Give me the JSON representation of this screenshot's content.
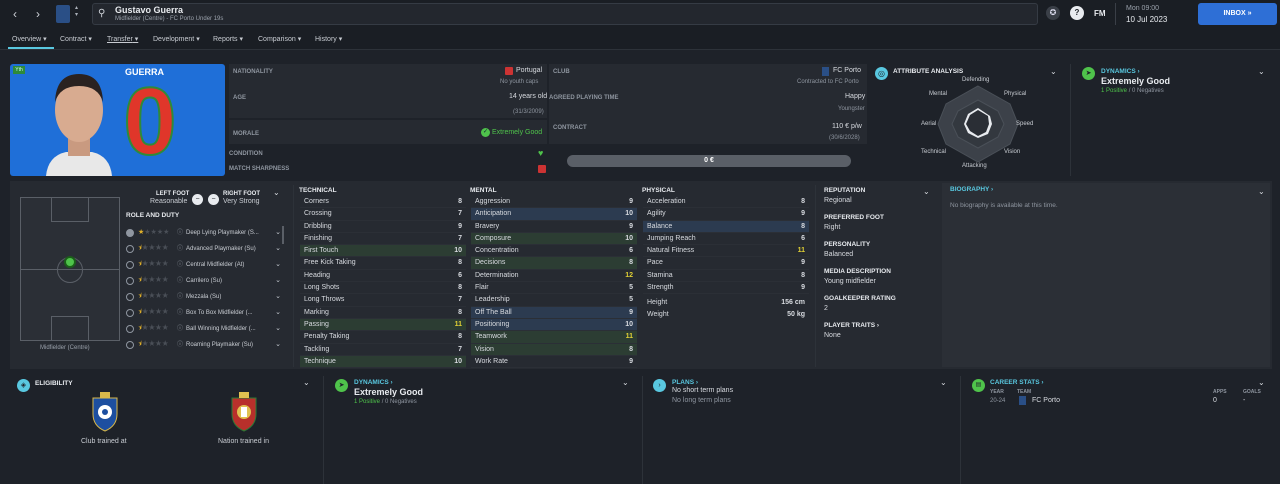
{
  "top": {
    "player_name": "Gustavo Guerra",
    "player_subtitle": "Midfielder (Centre) - FC Porto Under 19s",
    "day_time": "Mon 09:00",
    "date": "10 Jul 2023",
    "fm": "FM",
    "inbox": "INBOX"
  },
  "tabs": [
    "Overview",
    "Contract",
    "Transfer",
    "Development",
    "Reports",
    "Comparison",
    "History"
  ],
  "profile": {
    "yth_badge": "Yth",
    "shirt_name": "GUERRA",
    "shirt_number": "0"
  },
  "info": {
    "nationality_label": "NATIONALITY",
    "nationality": "Portugal",
    "youth_caps": "No youth caps",
    "club_label": "CLUB",
    "club": "FC Porto",
    "club_sub": "Contracted to FC Porto",
    "age_label": "AGE",
    "age": "14 years old",
    "dob": "(31/3/2009)",
    "playing_time_label": "AGREED PLAYING TIME",
    "playing_time": "Happy",
    "playing_time_sub": "Youngster",
    "morale_label": "MORALE",
    "morale": "Extremely Good",
    "contract_label": "CONTRACT",
    "contract": "110 € p/w",
    "contract_end": "(30/6/2028)",
    "condition_label": "CONDITION",
    "sharpness_label": "MATCH SHARPNESS",
    "value": "0 €"
  },
  "attribute_analysis": {
    "title": "ATTRIBUTE ANALYSIS",
    "labels": [
      "Defending",
      "Physical",
      "Speed",
      "Vision",
      "Attacking",
      "Technical",
      "Aerial",
      "Mental"
    ]
  },
  "dynamics_top": {
    "title": "DYNAMICS",
    "value": "Extremely Good",
    "positive": "1 Positive",
    "slash": "/",
    "negative": "0 Negatives"
  },
  "feet": {
    "left_label": "LEFT FOOT",
    "left": "Reasonable",
    "right_label": "RIGHT FOOT",
    "right": "Very Strong"
  },
  "pitch": {
    "position": "Midfielder (Centre)"
  },
  "roles": {
    "title": "ROLE AND DUTY",
    "items": [
      "Deep Lying Playmaker (S...",
      "Advanced Playmaker (Su)",
      "Central Midfielder (At)",
      "Carrilero (Su)",
      "Mezzala (Su)",
      "Box To Box Midfielder (...",
      "Ball Winning Midfielder (...",
      "Roaming Playmaker (Su)"
    ]
  },
  "technical": {
    "title": "TECHNICAL",
    "rows": [
      [
        "Corners",
        "8",
        ""
      ],
      [
        "Crossing",
        "7",
        ""
      ],
      [
        "Dribbling",
        "9",
        ""
      ],
      [
        "Finishing",
        "7",
        ""
      ],
      [
        "First Touch",
        "10",
        "g"
      ],
      [
        "Free Kick Taking",
        "8",
        ""
      ],
      [
        "Heading",
        "6",
        ""
      ],
      [
        "Long Shots",
        "8",
        ""
      ],
      [
        "Long Throws",
        "7",
        ""
      ],
      [
        "Marking",
        "8",
        ""
      ],
      [
        "Passing",
        "11",
        "g"
      ],
      [
        "Penalty Taking",
        "8",
        ""
      ],
      [
        "Tackling",
        "7",
        ""
      ],
      [
        "Technique",
        "10",
        "g"
      ]
    ]
  },
  "mental": {
    "title": "MENTAL",
    "rows": [
      [
        "Aggression",
        "9",
        ""
      ],
      [
        "Anticipation",
        "10",
        "b"
      ],
      [
        "Bravery",
        "9",
        ""
      ],
      [
        "Composure",
        "10",
        "g"
      ],
      [
        "Concentration",
        "6",
        ""
      ],
      [
        "Decisions",
        "8",
        "g"
      ],
      [
        "Determination",
        "12",
        ""
      ],
      [
        "Flair",
        "5",
        ""
      ],
      [
        "Leadership",
        "5",
        ""
      ],
      [
        "Off The Ball",
        "9",
        "b"
      ],
      [
        "Positioning",
        "10",
        "b"
      ],
      [
        "Teamwork",
        "11",
        "g"
      ],
      [
        "Vision",
        "8",
        "g"
      ],
      [
        "Work Rate",
        "9",
        ""
      ]
    ]
  },
  "physical": {
    "title": "PHYSICAL",
    "rows": [
      [
        "Acceleration",
        "8",
        ""
      ],
      [
        "Agility",
        "9",
        ""
      ],
      [
        "Balance",
        "8",
        "b"
      ],
      [
        "Jumping Reach",
        "6",
        ""
      ],
      [
        "Natural Fitness",
        "11",
        ""
      ],
      [
        "Pace",
        "9",
        ""
      ],
      [
        "Stamina",
        "8",
        ""
      ],
      [
        "Strength",
        "9",
        ""
      ]
    ],
    "height_label": "Height",
    "height": "156 cm",
    "weight_label": "Weight",
    "weight": "50 kg"
  },
  "side_info": {
    "reputation_label": "REPUTATION",
    "reputation": "Regional",
    "foot_label": "PREFERRED FOOT",
    "foot": "Right",
    "personality_label": "PERSONALITY",
    "personality": "Balanced",
    "media_label": "MEDIA DESCRIPTION",
    "media": "Young midfielder",
    "gk_label": "GOALKEEPER RATING",
    "gk": "2",
    "traits_label": "PLAYER TRAITS",
    "traits": "None"
  },
  "biography": {
    "title": "BIOGRAPHY",
    "text": "No biography is available at this time."
  },
  "eligibility": {
    "title": "ELIGIBILITY",
    "club": "Club trained at",
    "nation": "Nation trained in"
  },
  "dynamics_bottom": {
    "title": "DYNAMICS",
    "value": "Extremely Good",
    "positive": "1 Positive",
    "slash": "/",
    "negative": "0 Negatives"
  },
  "plans": {
    "title": "PLANS",
    "short": "No short term plans",
    "long": "No long term plans"
  },
  "career": {
    "title": "CAREER STATS",
    "year_label": "YEAR",
    "team_label": "TEAM",
    "apps_label": "APPS",
    "goals_label": "GOALS",
    "year": "20-24",
    "team": "FC Porto",
    "apps": "0",
    "goals": "-"
  },
  "colors": {
    "accent": "#59c8e0",
    "green": "#4fc34b",
    "shirt": "#1f6fd8",
    "shirt_number": "#e0362a",
    "inbox": "#2e6fd6"
  }
}
